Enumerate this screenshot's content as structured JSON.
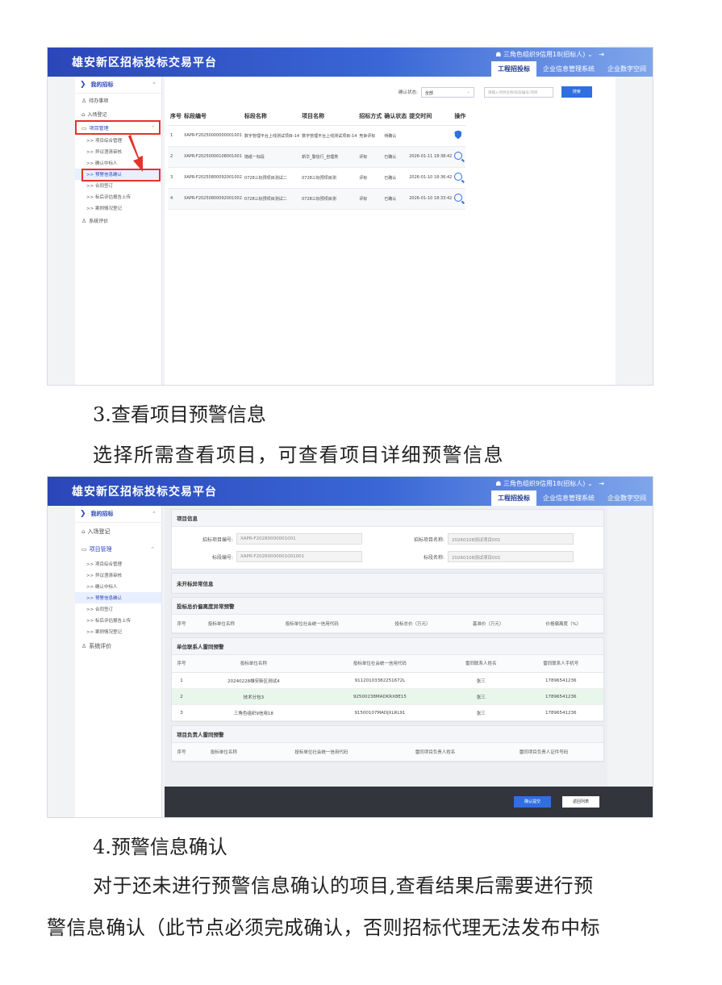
{
  "screenshot1": {
    "platform_title": "雄安新区招标投标交易平台",
    "user": "三角色组织9信用18(招标人)",
    "tabs": [
      "工程招投标",
      "企业信息管理系统",
      "企业数字空间"
    ],
    "sidebar": {
      "header": "我的招标",
      "items": [
        "待办事项",
        "入场登记",
        "项目管理"
      ],
      "sub_items": [
        "项目综合管理",
        "异议澄清审核",
        "确认中标人",
        "预警信息确认",
        "合同签订",
        "标后评估报告上传",
        "案例情况登记"
      ],
      "last_item": "系统评价"
    },
    "filter": {
      "label": "确认状态:",
      "select_value": "全部",
      "search_placeholder": "请输入项目名称/标段编号/项目",
      "search_button": "搜索"
    },
    "table": {
      "headers": [
        "序号",
        "标段编号",
        "标段名称",
        "项目名称",
        "招标方式",
        "确认状态",
        "提交时间",
        "操作"
      ],
      "rows": [
        [
          "1",
          "XAPR-F20250000000001001",
          "数字管理平台上线测试项目-14",
          "数字管理平台上线测试项目-14",
          "竞争评标",
          "待确认",
          "",
          "shield"
        ],
        [
          "2",
          "XAPR-F20250000108001001",
          "墙纸一标段",
          "新华_警信行_自理类",
          "评标",
          "已确认",
          "2026-01-11 18:38:42",
          "search"
        ],
        [
          "3",
          "XAPR-F20250800092001002",
          "0728三标预项目测试二",
          "0728三标预项目测",
          "评标",
          "已确认",
          "2026-01-10 18:36:42",
          "search"
        ],
        [
          "4",
          "XAPR-F20250800092001002",
          "0728三标预项目测试二",
          "0728三标预项目测",
          "评标",
          "已确认",
          "2026-01-10 18:33:42",
          "search"
        ]
      ]
    }
  },
  "section3": {
    "heading": "3.查看项目预警信息",
    "body": "选择所需查看项目，可查看项目详细预警信息"
  },
  "screenshot2": {
    "platform_title": "雄安新区招标投标交易平台",
    "user": "三角色组织9信用18(招标人)",
    "tabs": [
      "工程招投标",
      "企业信息管理系统",
      "企业数字空间"
    ],
    "sidebar": {
      "header": "我的招标",
      "items": [
        "入场登记",
        "项目管理"
      ],
      "sub_items": [
        "项目综合管理",
        "异议澄清审核",
        "确认中标人",
        "预警信息确认",
        "合同签订",
        "标后评估报告上传",
        "案例情况登记"
      ],
      "last_item": "系统评价"
    },
    "project_info": {
      "title": "项目信息",
      "project_code_label": "招标项目编号:",
      "project_code": "XAPR-F20280000001001",
      "project_name_label": "招标项目名称:",
      "project_name": "20260108测试项目001",
      "section_code_label": "标段编号:",
      "section_code": "XAPR-F20260000001001001",
      "section_name_label": "标段名称:",
      "section_name": "20260108测试项目001"
    },
    "unopened_title": "未开标异常信息",
    "price_deviation": {
      "title": "投标总价偏离度异常预警",
      "headers": [
        "序号",
        "投标单位名称",
        "投标单位社会统一信用代码",
        "投标总价（万元）",
        "基准价（万元）",
        "价格偏离度（%）"
      ]
    },
    "contact_warning": {
      "title": "单位联系人雷同预警",
      "headers": [
        "序号",
        "投标单位名称",
        "投标单位社会统一信用代码",
        "雷同联系人姓名",
        "雷同联系人手机号"
      ],
      "rows": [
        [
          "1",
          "20240228雄安新区测试4",
          "91120103382251672L",
          "张三",
          "17896541236"
        ],
        [
          "2",
          "技术分包3",
          "92500238MADKRX8E15",
          "张三",
          "17896541236"
        ],
        [
          "3",
          "三角色组织9信用18",
          "91500107MADJXLRL91",
          "张三",
          "17896541236"
        ]
      ]
    },
    "manager_warning": {
      "title": "项目负责人雷同预警",
      "headers": [
        "序号",
        "投标单位名称",
        "投标单位社会统一信用代码",
        "雷同项目负责人姓名",
        "雷同项目负责人证件号码"
      ]
    },
    "footer": {
      "confirm_button": "确认提交",
      "back_button": "返回列表"
    }
  },
  "section4": {
    "heading": "4.预警信息确认",
    "body_line1": "对于还未进行预警信息确认的项目,查看结果后需要进行预",
    "body_line2": "警信息确认（此节点必须完成确认，否则招标代理无法发布中标"
  }
}
